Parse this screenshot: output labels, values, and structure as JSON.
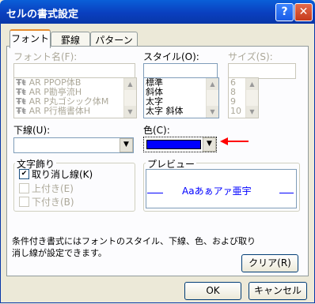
{
  "window": {
    "title": "セルの書式設定",
    "help_glyph": "?",
    "close_glyph": "✕"
  },
  "tabs": [
    "フォント",
    "罫線",
    "パターン"
  ],
  "font": {
    "label": "フォント名(F):",
    "value": "",
    "items": [
      "AR PPOP体B",
      "AR P勘亭流H",
      "AR P丸ゴシック体M",
      "AR P行楷書体H"
    ]
  },
  "style": {
    "label": "スタイル(O):",
    "value": "",
    "items": [
      "標準",
      "斜体",
      "太字",
      "太字 斜体"
    ]
  },
  "size": {
    "label": "サイズ(S):",
    "value": "",
    "items": [
      "6",
      "8",
      "9",
      "10"
    ]
  },
  "underline": {
    "label": "下線(U):",
    "value": ""
  },
  "color": {
    "label": "色(C):",
    "swatch": "#0000ff"
  },
  "effects": {
    "title": "文字飾り",
    "items": [
      {
        "label": "取り消し線(K)",
        "checked": true,
        "enabled": true
      },
      {
        "label": "上付き(E)",
        "checked": false,
        "enabled": false
      },
      {
        "label": "下付き(B)",
        "checked": false,
        "enabled": false
      }
    ]
  },
  "preview": {
    "title": "プレビュー",
    "text": "Aaあぁアァ亜宇",
    "color": "#0000ff"
  },
  "note": "条件付き書式にはフォントのスタイル、下線、色、および取り消し線が設定できます。",
  "buttons": {
    "clear": "クリア(R)",
    "ok": "OK",
    "cancel": "キャンセル"
  },
  "annotation": {
    "arrow_color": "#ff0000"
  }
}
